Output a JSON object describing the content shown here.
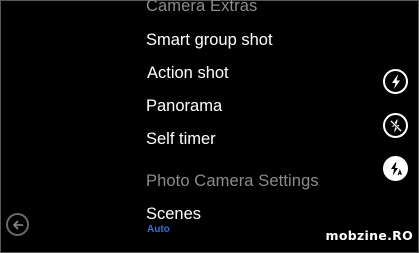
{
  "menu": {
    "camera_extras_header": "Camera Extras",
    "items": [
      {
        "label": "Smart group shot"
      },
      {
        "label": "Action shot"
      },
      {
        "label": "Panorama"
      },
      {
        "label": "Self timer"
      }
    ],
    "photo_settings_header": "Photo Camera Settings",
    "scenes": {
      "label": "Scenes",
      "value": "Auto"
    }
  },
  "side_buttons": [
    {
      "icon": "flash-on-icon"
    },
    {
      "icon": "flash-off-icon"
    },
    {
      "icon": "flash-auto-icon"
    }
  ],
  "back_button": {
    "icon": "back-arrow-icon"
  },
  "watermark": {
    "text": "mobzine.RO"
  },
  "colors": {
    "background": "#000000",
    "text": "#ffffff",
    "header_text": "#8c8c8c",
    "accent": "#2f73d6"
  }
}
